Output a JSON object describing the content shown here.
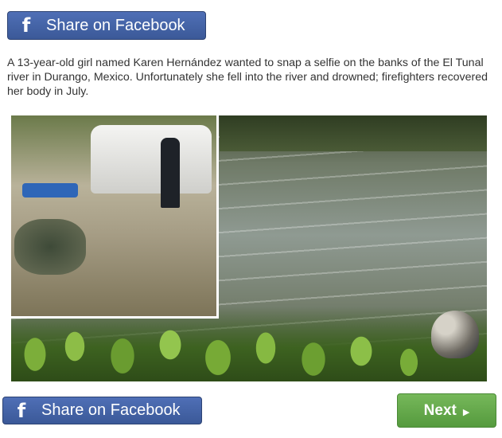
{
  "share_top": {
    "icon": "facebook-icon",
    "icon_glyph": "f",
    "label": "Share on Facebook"
  },
  "article": {
    "text": "A 13-year-old girl named Karen Hernández wanted to snap a selfie on the banks of the El Tunal river in Durango, Mexico. Unfortunately she fell into the river and drowned; firefighters recovered her body in July."
  },
  "share_bottom": {
    "icon": "facebook-icon",
    "icon_glyph": "f",
    "label": "Share on Facebook"
  },
  "next": {
    "label": "Next",
    "icon": "play-arrow-icon",
    "icon_glyph": "▶"
  },
  "colors": {
    "facebook_blue": "#3b5998",
    "next_green": "#5fa545"
  }
}
